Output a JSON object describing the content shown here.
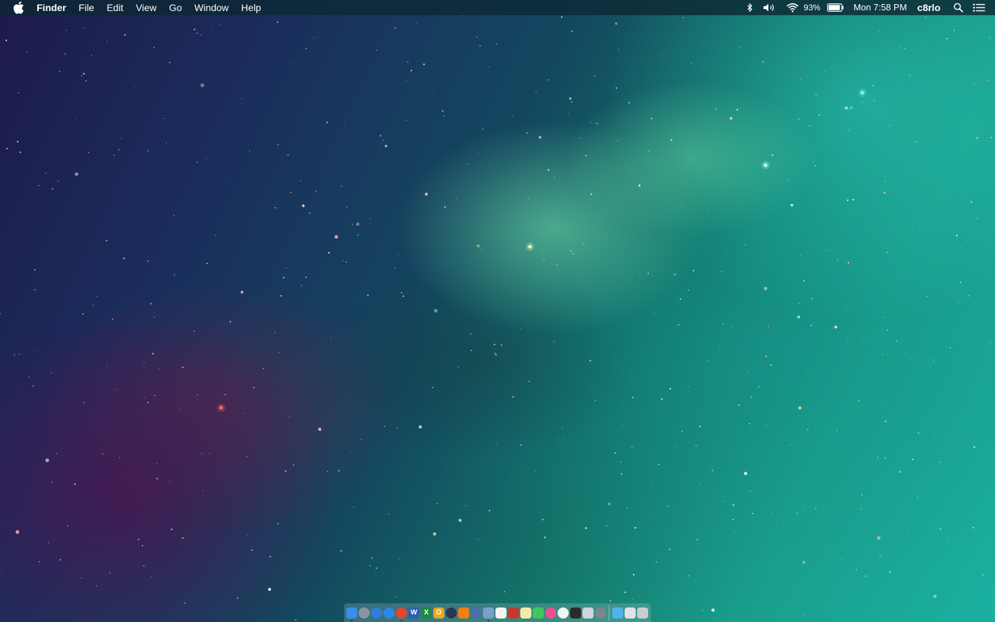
{
  "menubar": {
    "apple_icon": "apple-logo-icon",
    "app_name": "Finder",
    "menus": [
      "File",
      "Edit",
      "View",
      "Go",
      "Window",
      "Help"
    ],
    "status": {
      "bluetooth_icon": "bluetooth-icon",
      "volume_icon": "volume-icon",
      "wifi_icon": "wifi-icon",
      "battery_percent": "93%",
      "battery_icon": "battery-icon",
      "battery_level": 0.93,
      "datetime": "Mon 7:58 PM",
      "username": "c8rlo",
      "spotlight_icon": "search-icon",
      "notifications_icon": "notification-center-icon"
    }
  },
  "dock": {
    "apps": [
      {
        "name": "finder",
        "color": "#3a8ee6",
        "glyph": "",
        "running": true
      },
      {
        "name": "launchpad",
        "color": "#8a94a6",
        "glyph": "",
        "running": false
      },
      {
        "name": "app-store",
        "color": "#2f7de1",
        "glyph": "",
        "running": false
      },
      {
        "name": "safari",
        "color": "#2e87e6",
        "glyph": "",
        "running": false
      },
      {
        "name": "chrome",
        "color": "#e5442f",
        "glyph": "",
        "running": true
      },
      {
        "name": "word",
        "color": "#2b5fb4",
        "glyph": "W",
        "running": false
      },
      {
        "name": "excel",
        "color": "#1f8a48",
        "glyph": "X",
        "running": false
      },
      {
        "name": "outlook",
        "color": "#e8a823",
        "glyph": "O",
        "running": false
      },
      {
        "name": "steam",
        "color": "#27384f",
        "glyph": "",
        "running": false
      },
      {
        "name": "vlc",
        "color": "#f07f16",
        "glyph": "",
        "running": false
      },
      {
        "name": "network-utility",
        "color": "#4d6fa8",
        "glyph": "",
        "running": false
      },
      {
        "name": "preview",
        "color": "#7aa0c8",
        "glyph": "",
        "running": true
      },
      {
        "name": "calendar",
        "color": "#f4f4f4",
        "glyph": "",
        "running": false
      },
      {
        "name": "photo-booth",
        "color": "#c23b2e",
        "glyph": "",
        "running": false
      },
      {
        "name": "notes",
        "color": "#f5e9a8",
        "glyph": "",
        "running": false
      },
      {
        "name": "messages",
        "color": "#3ec95d",
        "glyph": "",
        "running": false
      },
      {
        "name": "itunes",
        "color": "#f14e8c",
        "glyph": "",
        "running": false
      },
      {
        "name": "photos",
        "color": "#f4f4f4",
        "glyph": "",
        "running": false
      },
      {
        "name": "terminal",
        "color": "#2a2a2a",
        "glyph": "",
        "running": false
      },
      {
        "name": "mail",
        "color": "#cfd6dd",
        "glyph": "",
        "running": false
      },
      {
        "name": "system-preferences",
        "color": "#7d8590",
        "glyph": "",
        "running": false
      }
    ],
    "stacks": [
      {
        "name": "applications-folder",
        "color": "#4fb3ea"
      },
      {
        "name": "downloads-folder",
        "color": "#dfe3e7"
      },
      {
        "name": "trash",
        "color": "#c8cdd2"
      }
    ]
  }
}
